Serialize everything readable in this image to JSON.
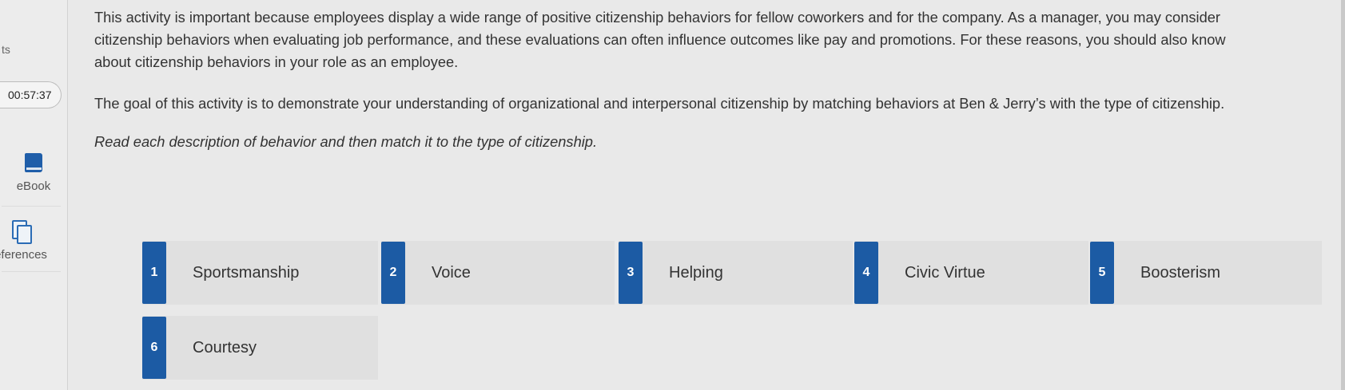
{
  "sidebar": {
    "partial_label": "ts",
    "timer": "00:57:37",
    "tools": [
      {
        "label": "eBook",
        "icon": "book-icon"
      },
      {
        "label": "eferences",
        "icon": "references-icon"
      }
    ]
  },
  "content": {
    "paragraph_1": "This activity is important because employees display a wide range of positive citizenship behaviors for fellow coworkers and for the company. As a manager, you may consider citizenship behaviors when evaluating job performance, and these evaluations can often influence outcomes like pay and promotions. For these reasons, you should also know about citizenship behaviors in your role as an employee.",
    "paragraph_2": "The goal of this activity is to demonstrate your understanding of organizational and interpersonal citizenship by matching behaviors at Ben & Jerry’s with the type of citizenship.",
    "instruction": "Read each description of behavior and then match it to the type of citizenship."
  },
  "cards": [
    {
      "number": "1",
      "label": "Sportsmanship"
    },
    {
      "number": "2",
      "label": "Voice"
    },
    {
      "number": "3",
      "label": "Helping"
    },
    {
      "number": "4",
      "label": "Civic Virtue"
    },
    {
      "number": "5",
      "label": "Boosterism"
    },
    {
      "number": "6",
      "label": "Courtesy"
    }
  ],
  "colors": {
    "accent": "#1c5ba4",
    "background": "#e9e9e9",
    "card_background": "#e0e0e0"
  }
}
